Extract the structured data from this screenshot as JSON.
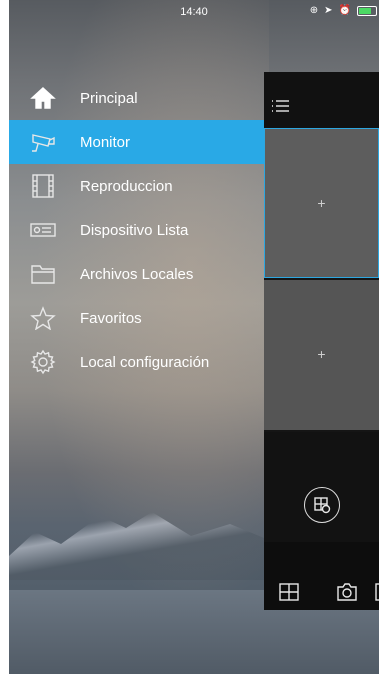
{
  "status_bar": {
    "time": "14:40"
  },
  "menu": {
    "items": [
      {
        "label": "Principal",
        "icon": "home-icon"
      },
      {
        "label": "Monitor",
        "icon": "cctv-camera-icon"
      },
      {
        "label": "Reproduccion",
        "icon": "film-icon"
      },
      {
        "label": "Dispositivo Lista",
        "icon": "dvr-device-icon"
      },
      {
        "label": "Archivos Locales",
        "icon": "folder-icon"
      },
      {
        "label": "Favoritos",
        "icon": "star-icon"
      },
      {
        "label": "Local configuración",
        "icon": "gear-icon"
      }
    ],
    "active_index": 1
  },
  "monitor": {
    "tile_1_label": "+",
    "tile_2_label": "+"
  },
  "colors": {
    "accent": "#29a9e6"
  }
}
